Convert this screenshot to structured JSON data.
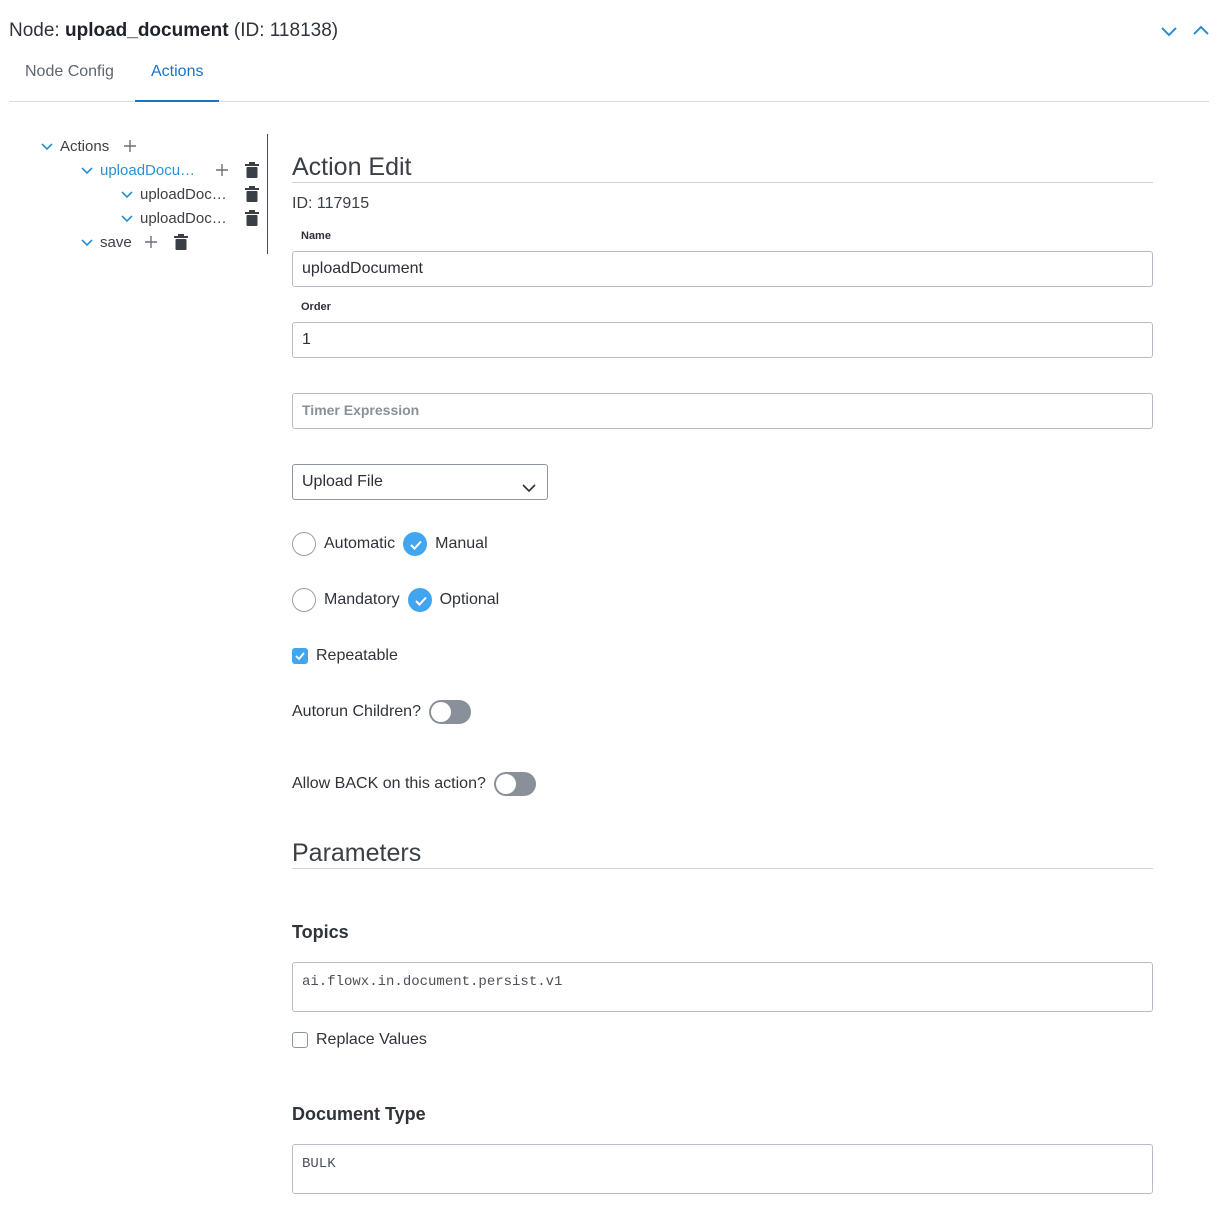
{
  "header": {
    "node_prefix": "Node:",
    "node_name": "upload_document",
    "node_id_text": "(ID: 118138)",
    "icons": [
      "chevron-down-icon",
      "chevron-up-icon"
    ],
    "accent": "#1a73c8"
  },
  "tabs": [
    {
      "label": "Node Config",
      "active": false
    },
    {
      "label": "Actions",
      "active": true
    }
  ],
  "tree": {
    "root": "Actions",
    "items": [
      {
        "label": "uploadDocu…",
        "level": 1,
        "selected": true
      },
      {
        "label": "uploadDoc…",
        "level": 2
      },
      {
        "label": "uploadDoc…",
        "level": 2
      },
      {
        "label": "save",
        "level": 1
      }
    ],
    "selected_color": "#2a90d6"
  },
  "action_edit": {
    "title": "Action Edit",
    "id_text": "ID: 117915",
    "name_label": "Name",
    "name_value": "uploadDocument",
    "order_label": "Order",
    "order_value": "1",
    "timer_placeholder": "Timer Expression",
    "timer_value": "",
    "type_selected": "Upload File",
    "trigger": {
      "options": [
        "Automatic",
        "Manual"
      ],
      "selected": "Manual"
    },
    "requirement": {
      "options": [
        "Mandatory",
        "Optional"
      ],
      "selected": "Optional"
    },
    "repeatable_label": "Repeatable",
    "repeatable_checked": true,
    "autorun_label": "Autorun Children?",
    "autorun_on": false,
    "allow_back_label": "Allow BACK on this action?",
    "allow_back_on": false
  },
  "parameters": {
    "title": "Parameters",
    "topics_label": "Topics",
    "topics_value": "ai.flowx.in.document.persist.v1",
    "replace_values_label": "Replace Values",
    "replace_values_checked": false,
    "document_type_label": "Document Type",
    "document_type_value": "BULK"
  },
  "colors": {
    "checked_blue": "#42a5ef",
    "toggle_off": "#8a9099"
  }
}
